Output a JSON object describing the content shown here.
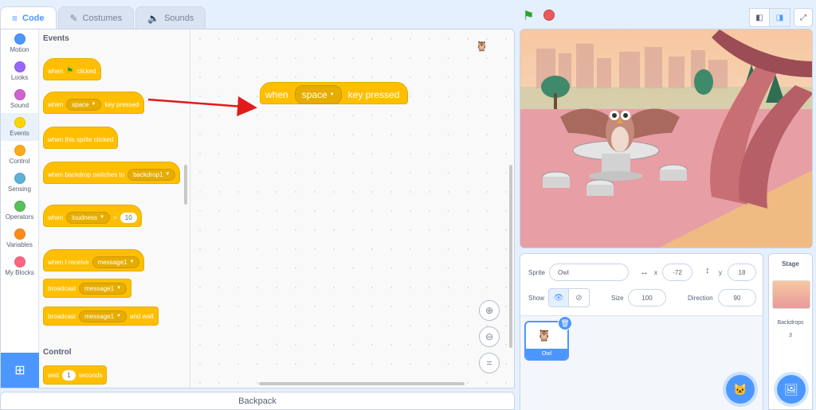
{
  "tabs": [
    {
      "label": "Code",
      "icon": "code-icon"
    },
    {
      "label": "Costumes",
      "icon": "brush-icon"
    },
    {
      "label": "Sounds",
      "icon": "speaker-icon"
    }
  ],
  "categories": [
    {
      "label": "Motion",
      "color": "#4c97ff"
    },
    {
      "label": "Looks",
      "color": "#9966ff"
    },
    {
      "label": "Sound",
      "color": "#cf63cf"
    },
    {
      "label": "Events",
      "color": "#ffd500"
    },
    {
      "label": "Control",
      "color": "#ffab19"
    },
    {
      "label": "Sensing",
      "color": "#5cb1d6"
    },
    {
      "label": "Operators",
      "color": "#59c059"
    },
    {
      "label": "Variables",
      "color": "#ff8c1a"
    },
    {
      "label": "My Blocks",
      "color": "#ff6680"
    }
  ],
  "palette": {
    "events_title": "Events",
    "control_title": "Control",
    "when": "when",
    "clicked": "clicked",
    "key_pressed": "key pressed",
    "space": "space",
    "this_sprite_clicked": "when this sprite clicked",
    "backdrop_switches_to": "when backdrop switches to",
    "backdrop1": "backdrop1",
    "loudness": "loudness",
    "gt": ">",
    "ten": "10",
    "when_i_receive": "when I receive",
    "message1": "message1",
    "broadcast": "broadcast",
    "and_wait": "and wait",
    "wait": "wait",
    "one": "1",
    "seconds": "seconds"
  },
  "workspace": {
    "when": "when",
    "key": "space",
    "key_pressed": "key pressed"
  },
  "backpack": "Backpack",
  "sprite": {
    "sprite_label": "Sprite",
    "name": "Owl",
    "x_label": "x",
    "x": "-72",
    "y_label": "y",
    "y": "18",
    "show_label": "Show",
    "size_label": "Size",
    "size": "100",
    "direction_label": "Direction",
    "direction": "90",
    "thumb_name": "Owl"
  },
  "stage_pane": {
    "title": "Stage",
    "backdrops_label": "Backdrops",
    "backdrops_count": "3"
  },
  "colors": {
    "events": "#ffbf00",
    "accent": "#4c97ff"
  }
}
